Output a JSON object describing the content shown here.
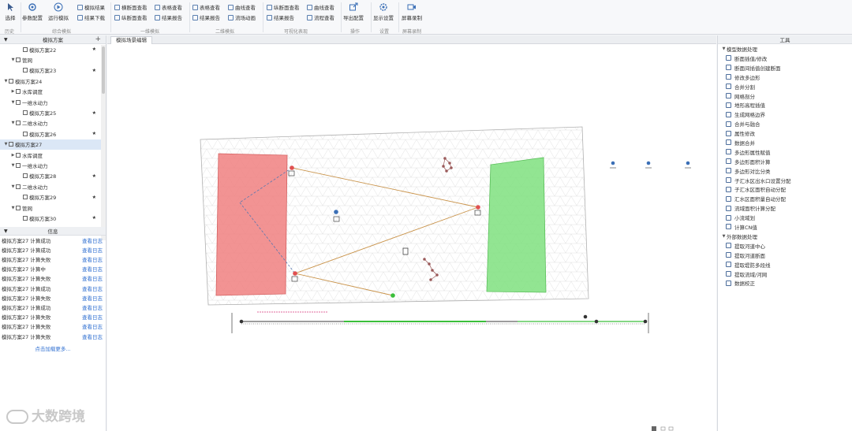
{
  "ribbon": {
    "groups": [
      {
        "label": "历史"
      },
      {
        "label": "综合模拟"
      },
      {
        "label": "一维模拟"
      },
      {
        "label": "二维模拟"
      },
      {
        "label": "可视化表现"
      },
      {
        "label": "操作"
      },
      {
        "label": "设置"
      },
      {
        "label": "屏幕录制"
      }
    ],
    "large_buttons": [
      {
        "label": "选择"
      },
      {
        "label": "参数配置"
      },
      {
        "label": "运行模拟"
      },
      {
        "label": "导出配置"
      },
      {
        "label": "显示设置"
      },
      {
        "label": "屏幕录制"
      }
    ],
    "small_buttons": [
      [
        "模拟结果",
        "结果下载"
      ],
      [
        "横断面查看",
        "纵断面查看"
      ],
      [
        "表格查看",
        "结果报告"
      ],
      [
        "表格查看",
        "结果报告"
      ],
      [
        "曲线查看",
        "流场动画"
      ],
      [
        "纵断面查看",
        "结果报告"
      ],
      [
        "曲线查看",
        "流程查看"
      ]
    ]
  },
  "left_panel": {
    "scheme_header": "模拟方案",
    "tree": [
      {
        "label": "模拟方案22",
        "indent": 2,
        "star": true,
        "toggle": ""
      },
      {
        "label": "管网",
        "indent": 1,
        "star": false,
        "toggle": "▼"
      },
      {
        "label": "模拟方案23",
        "indent": 2,
        "star": true,
        "toggle": ""
      },
      {
        "label": "模拟方案24",
        "indent": 0,
        "star": false,
        "toggle": "▼"
      },
      {
        "label": "水库调度",
        "indent": 1,
        "star": false,
        "toggle": "▶"
      },
      {
        "label": "一维水动力",
        "indent": 1,
        "star": false,
        "toggle": "▼"
      },
      {
        "label": "模拟方案25",
        "indent": 2,
        "star": true,
        "toggle": ""
      },
      {
        "label": "二维水动力",
        "indent": 1,
        "star": false,
        "toggle": "▼"
      },
      {
        "label": "模拟方案26",
        "indent": 2,
        "star": true,
        "toggle": ""
      },
      {
        "label": "模拟方案27",
        "indent": 0,
        "star": false,
        "toggle": "▼",
        "selected": true
      },
      {
        "label": "水库调度",
        "indent": 1,
        "star": false,
        "toggle": "▶"
      },
      {
        "label": "一维水动力",
        "indent": 1,
        "star": false,
        "toggle": "▼"
      },
      {
        "label": "模拟方案28",
        "indent": 2,
        "star": true,
        "toggle": ""
      },
      {
        "label": "二维水动力",
        "indent": 1,
        "star": false,
        "toggle": "▼"
      },
      {
        "label": "模拟方案29",
        "indent": 2,
        "star": true,
        "toggle": ""
      },
      {
        "label": "管网",
        "indent": 1,
        "star": false,
        "toggle": "▼"
      },
      {
        "label": "模拟方案30",
        "indent": 2,
        "star": true,
        "toggle": ""
      }
    ],
    "log_header": "信息",
    "logs": [
      {
        "text": "模拟方案27 计算成功",
        "link": "查看日志"
      },
      {
        "text": "模拟方案27 计算成功",
        "link": "查看日志"
      },
      {
        "text": "模拟方案27 计算失败",
        "link": "查看日志"
      },
      {
        "text": "模拟方案27 计算中",
        "link": "查看日志"
      },
      {
        "text": "模拟方案27 计算失败",
        "link": "查看日志"
      },
      {
        "text": "模拟方案27 计算成功",
        "link": "查看日志"
      },
      {
        "text": "模拟方案27 计算失败",
        "link": "查看日志"
      },
      {
        "text": "模拟方案27 计算成功",
        "link": "查看日志"
      },
      {
        "text": "模拟方案27 计算失败",
        "link": "查看日志"
      },
      {
        "text": "模拟方案27 计算失败",
        "link": "查看日志"
      },
      {
        "text": "模拟方案27 计算失败",
        "link": "查看日志"
      }
    ],
    "more_link": "点击加载更多..."
  },
  "center": {
    "tab_label": "模拟场景编辑"
  },
  "right_panel": {
    "header": "工具",
    "categories": [
      {
        "label": "模型数据处理",
        "items": [
          "断面插值/修改",
          "断面间插值创建断面",
          "修改多边形",
          "合并分割",
          "网格剖分",
          "地形高程插值",
          "生成网格边界",
          "合并与融合",
          "属性修改",
          "数据合并",
          "多边形属性赋值",
          "多边形面积计算",
          "多边形对比分类",
          "子汇水区出水口设置分配",
          "子汇水区面积自动分配",
          "汇水区面积量自动分配",
          "流域面积计算分配",
          "小流域划",
          "计算CN值"
        ]
      },
      {
        "label": "外部数据处理",
        "items": [
          "提取河道中心",
          "提取河道断面",
          "提取堤防多段线",
          "提取流域/河网",
          "数据校正"
        ]
      }
    ]
  },
  "watermark": "大数跨境",
  "colors": {
    "red_zone": "#f08080",
    "green_zone": "#7fe07f",
    "link": "#2f6fd1",
    "selection": "#dbe7f6"
  }
}
